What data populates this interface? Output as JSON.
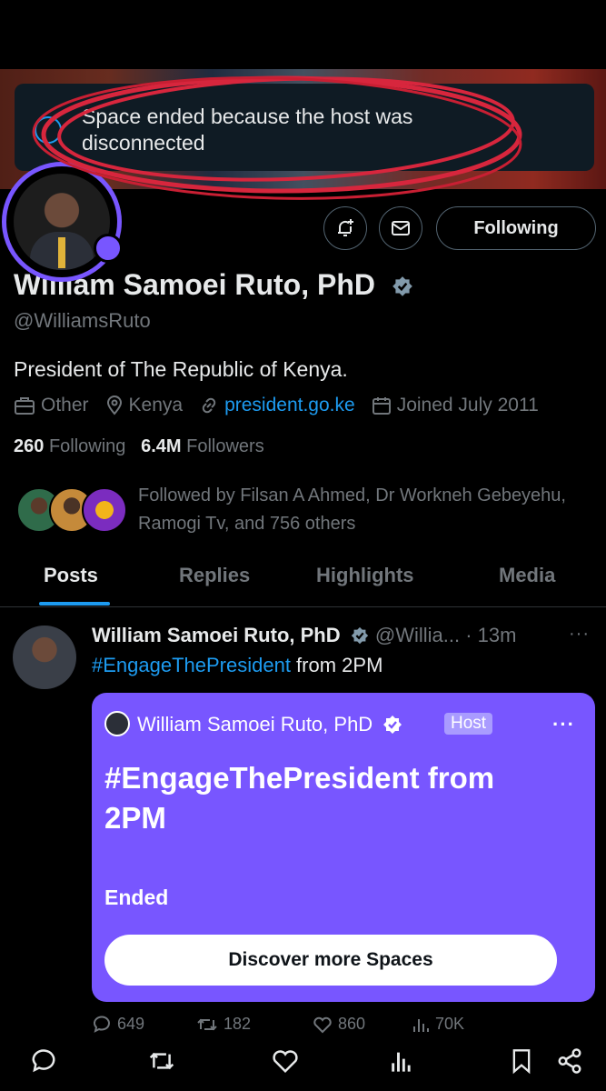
{
  "toast": {
    "message": "Space ended because the host was disconnected"
  },
  "profile": {
    "name": "William Samoei Ruto, PhD",
    "handle": "@WilliamsRuto",
    "bio": "President of The Republic of Kenya.",
    "category": "Other",
    "location": "Kenya",
    "website": "president.go.ke",
    "joined": "Joined July 2011",
    "following_count": "260",
    "following_label": "Following",
    "followers_count": "6.4M",
    "followers_label": "Followers",
    "follow_button": "Following",
    "mutuals": "Followed by Filsan A Ahmed, Dr Workneh Gebeyehu, Ramogi Tv, and 756 others"
  },
  "tabs": [
    "Posts",
    "Replies",
    "Highlights",
    "Media"
  ],
  "post": {
    "author": "William Samoei Ruto, PhD",
    "handle": "@Willia...",
    "time": "· 13m",
    "hashtag": "#EngageThePresident",
    "text_rest": " from 2PM",
    "space": {
      "host_name": "William Samoei Ruto, PhD",
      "host_badge": "Host",
      "title": "#EngageThePresident from 2PM",
      "status": "Ended",
      "button": "Discover more Spaces"
    },
    "stats": {
      "replies": "649",
      "reposts": "182",
      "likes": "860",
      "views": "70K"
    }
  },
  "colors": {
    "accent": "#1d9bf0",
    "space_purple": "#7856ff",
    "annotation_red": "#d7263d"
  },
  "icons": [
    "notification-plus-icon",
    "mail-icon",
    "verified-badge-icon",
    "briefcase-icon",
    "location-icon",
    "link-icon",
    "calendar-icon",
    "reply-icon",
    "repost-icon",
    "like-icon",
    "views-icon",
    "bookmark-icon",
    "share-icon"
  ]
}
